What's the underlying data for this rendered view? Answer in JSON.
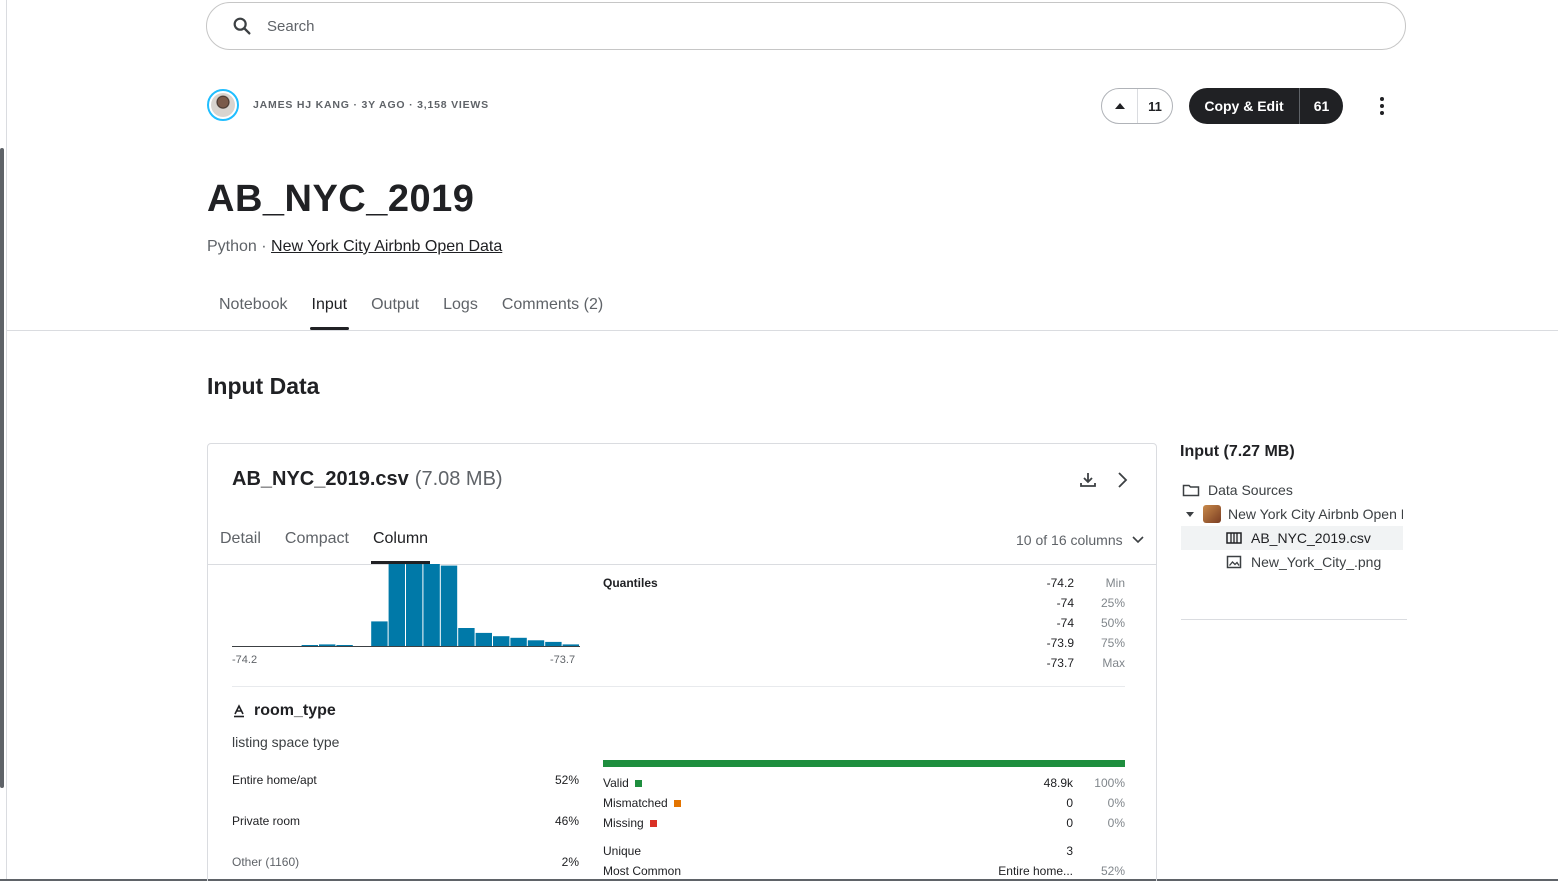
{
  "search": {
    "placeholder": "Search"
  },
  "header": {
    "author_meta": "JAMES HJ KANG · 3Y AGO · 3,158 VIEWS",
    "vote_count": "11",
    "copy_edit_label": "Copy & Edit",
    "copy_edit_count": "61"
  },
  "notebook": {
    "title": "AB_NYC_2019",
    "language": "Python",
    "separator": " · ",
    "dataset_link": "New York City Airbnb Open Data"
  },
  "tabs": [
    "Notebook",
    "Input",
    "Output",
    "Logs",
    "Comments (2)"
  ],
  "active_tab": "Input",
  "section_title": "Input Data",
  "file": {
    "name": "AB_NYC_2019.csv",
    "size": "(7.08 MB)",
    "subtabs": [
      "Detail",
      "Compact",
      "Column"
    ],
    "active_subtab": "Column",
    "column_selector": "10 of 16 columns"
  },
  "longitude": {
    "histogram_fractions": [
      0.0,
      0.0,
      0.0,
      0.0,
      0.005,
      0.02,
      0.005,
      0.0,
      0.3,
      1.0,
      1.0,
      1.0,
      0.98,
      0.22,
      0.16,
      0.12,
      0.1,
      0.07,
      0.05,
      0.02
    ],
    "min_label": "-74.2",
    "max_label": "-73.7",
    "quantiles_label": "Quantiles",
    "quantiles": [
      {
        "value": "-74.2",
        "label": "Min"
      },
      {
        "value": "-74",
        "label": "25%"
      },
      {
        "value": "-74",
        "label": "50%"
      },
      {
        "value": "-73.9",
        "label": "75%"
      },
      {
        "value": "-73.7",
        "label": "Max"
      }
    ]
  },
  "room_type": {
    "name": "room_type",
    "description": "listing space type",
    "categories": [
      {
        "name": "Entire home/apt",
        "pct": "52%"
      },
      {
        "name": "Private room",
        "pct": "46%"
      },
      {
        "name": "Other (1160)",
        "pct": "2%"
      }
    ],
    "valid_fraction": 1.0,
    "stats": {
      "valid": {
        "label": "Valid",
        "value": "48.9k",
        "pct": "100%",
        "color": "#1e8e3e"
      },
      "mismatched": {
        "label": "Mismatched",
        "value": "0",
        "pct": "0%",
        "color": "#e37400"
      },
      "missing": {
        "label": "Missing",
        "value": "0",
        "pct": "0%",
        "color": "#d93025"
      },
      "unique": {
        "label": "Unique",
        "value": "3"
      },
      "most_common": {
        "label": "Most Common",
        "value": "Entire home...",
        "pct": "52%"
      }
    }
  },
  "sidebar": {
    "title": "Input (7.27 MB)",
    "data_sources": "Data Sources",
    "dataset": "New York City Airbnb Open Data",
    "files": [
      "AB_NYC_2019.csv",
      "New_York_City_.png"
    ]
  },
  "colors": {
    "accent_bar": "#0079a8",
    "primary_dark": "#202124",
    "link_blue": "#20beff"
  }
}
